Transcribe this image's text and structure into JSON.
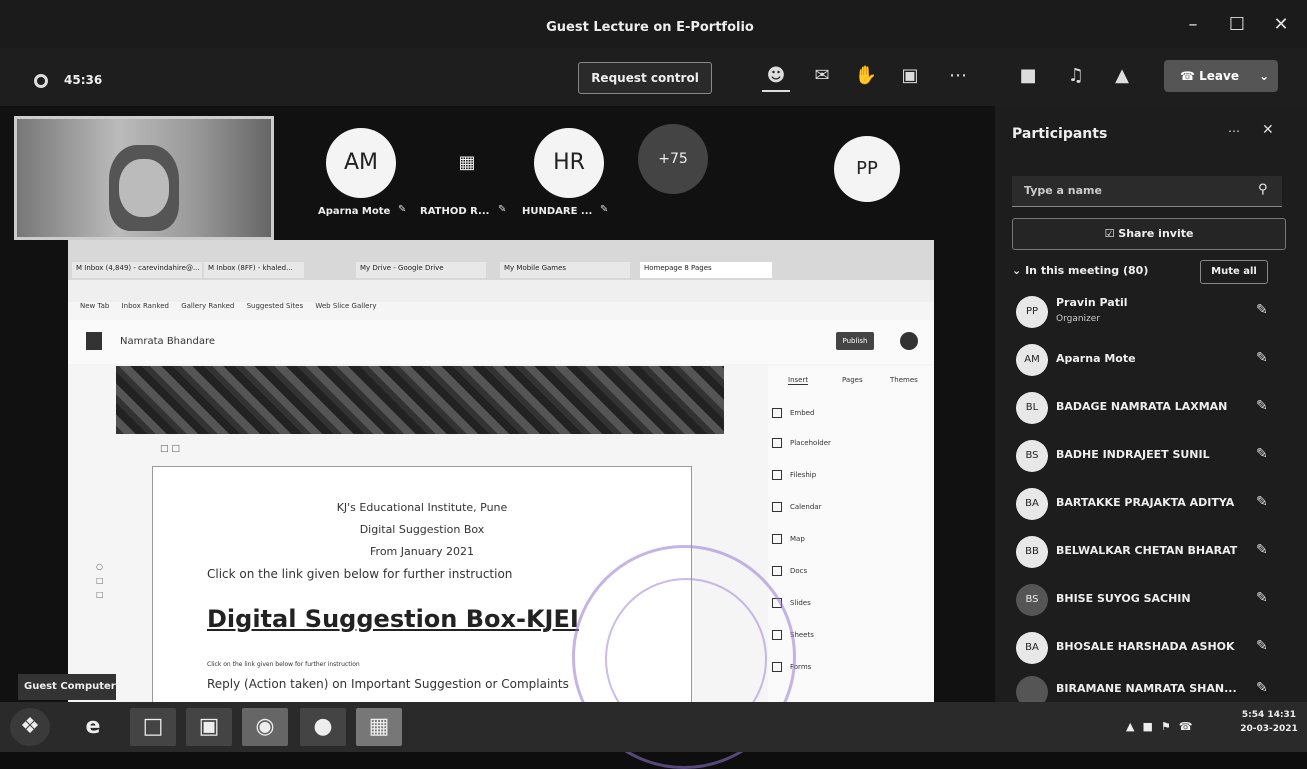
{
  "window": {
    "title": "Guest Lecture on E-Portfolio",
    "minimize": "–",
    "maximize": "☐",
    "close": "✕"
  },
  "toolbar": {
    "timer": "45:36",
    "request_control": "Request control",
    "leave": "Leave",
    "icons": [
      "people-icon",
      "chat-icon",
      "raise-hand-icon",
      "rooms-icon",
      "more-icon",
      "camera-icon",
      "mic-icon",
      "share-icon"
    ]
  },
  "stage": {
    "participants": [
      {
        "initials": "AM",
        "name": "Aparna Mote"
      },
      {
        "initials": "",
        "name": "RATHOD R..."
      },
      {
        "initials": "HR",
        "name": "HUNDARE ..."
      },
      {
        "initials": "+75",
        "name": ""
      },
      {
        "initials": "PP",
        "name": ""
      }
    ]
  },
  "shared_screen": {
    "browser_tabs": [
      "M Inbox (4,849) - carevindahire@...",
      "M Inbox (8FF) - khaled...",
      "My Drive - Google Drive",
      "My Mobile Games",
      "Homepage 8 Pages"
    ],
    "bookmarks": [
      "New Tab",
      "Inbox Ranked",
      "Gallery Ranked",
      "Suggested Sites",
      "Web Slice Gallery"
    ],
    "site_name": "Namrata Bhandare",
    "publish": "Publish",
    "side_tabs": [
      "Insert",
      "Pages",
      "Themes"
    ],
    "side_items": [
      "Embed",
      "Placeholder",
      "Fileship",
      "Calendar",
      "Map",
      "Docs",
      "Slides",
      "Sheets",
      "Forms"
    ],
    "doc": {
      "line1": "KJ's Educational Institute, Pune",
      "line2": "Digital Suggestion Box",
      "line3": "From January 2021",
      "line4": "Click on the link given below for further instruction",
      "heading": "Digital Suggestion Box-KJEI",
      "small": "Click on the link given below for further instruction",
      "line5": "Reply (Action taken) on Important Suggestion or Complaints"
    }
  },
  "participants_pane": {
    "title": "Participants",
    "search_placeholder": "Type a name",
    "share_invite": "Share invite",
    "in_meeting": "In this meeting (80)",
    "mute_all": "Mute all",
    "list": [
      {
        "initials": "PP",
        "name": "Pravin Patil",
        "role": "Organizer"
      },
      {
        "initials": "AM",
        "name": "Aparna Mote",
        "role": ""
      },
      {
        "initials": "BL",
        "name": "BADAGE NAMRATA LAXMAN",
        "role": ""
      },
      {
        "initials": "BS",
        "name": "BADHE INDRAJEET SUNIL",
        "role": ""
      },
      {
        "initials": "BA",
        "name": "BARTAKKE PRAJAKTA ADITYA",
        "role": ""
      },
      {
        "initials": "BB",
        "name": "BELWALKAR CHETAN BHARAT",
        "role": ""
      },
      {
        "initials": "BS",
        "name": "BHISE SUYOG SACHIN",
        "role": ""
      },
      {
        "initials": "BA",
        "name": "BHOSALE HARSHADA ASHOK",
        "role": ""
      },
      {
        "initials": "",
        "name": "BIRAMANE NAMRATA SHAN...",
        "role": ""
      }
    ]
  },
  "taskbar": {
    "guest_label": "Guest Computer",
    "apps": [
      "start-icon",
      "ie-icon",
      "explorer-icon",
      "store-icon",
      "chrome-icon",
      "firefox-icon",
      "teams-icon"
    ],
    "time": "5:54 14:31",
    "date": "20-03-2021"
  }
}
